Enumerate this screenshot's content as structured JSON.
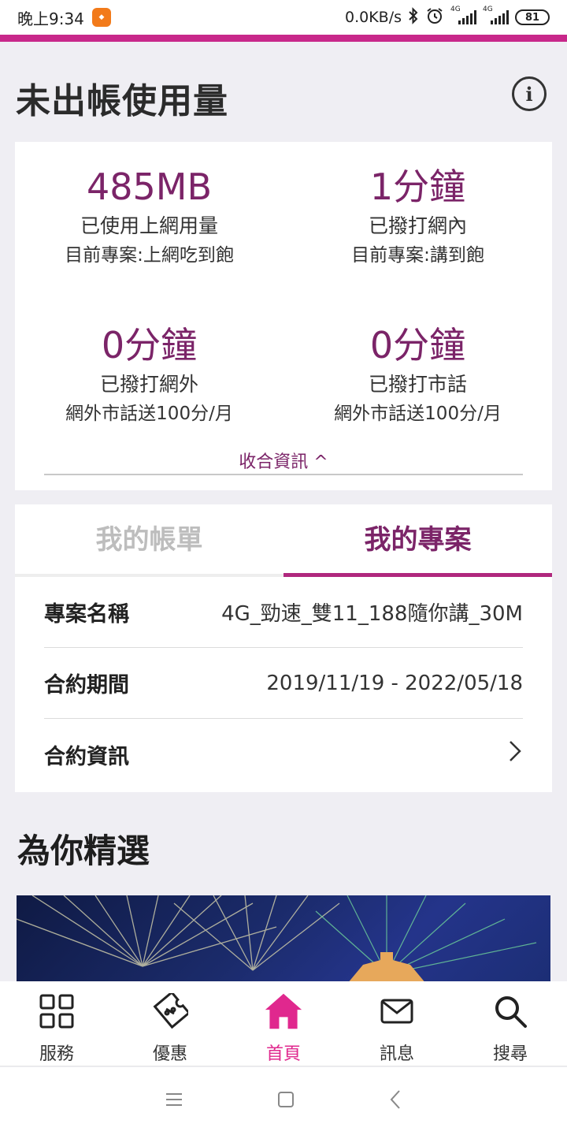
{
  "status_bar": {
    "time": "晚上9:34",
    "network_speed": "0.0KB/s",
    "signal_label_1": "4G",
    "signal_label_2": "4G",
    "battery": "81"
  },
  "header": {
    "title": "未出帳使用量",
    "info_icon": "info-icon"
  },
  "usage": {
    "items": [
      {
        "value": "485MB",
        "label": "已使用上網用量",
        "plan": "目前專案:上網吃到飽"
      },
      {
        "value": "1分鐘",
        "label": "已撥打網內",
        "plan": "目前專案:講到飽"
      },
      {
        "value": "0分鐘",
        "label": "已撥打網外",
        "plan": "網外市話送100分/月"
      },
      {
        "value": "0分鐘",
        "label": "已撥打市話",
        "plan": "網外市話送100分/月"
      }
    ],
    "collapse_label": "收合資訊 ^"
  },
  "tabs": [
    {
      "label": "我的帳單",
      "active": false
    },
    {
      "label": "我的專案",
      "active": true
    }
  ],
  "plan": {
    "name_label": "專案名稱",
    "name_value": "4G_勁速_雙11_188隨你講_30M",
    "period_label": "合約期間",
    "period_value": "2019/11/19 - 2022/05/18",
    "contract_label": "合約資訊"
  },
  "featured": {
    "title": "為你精選"
  },
  "bottom_nav": [
    {
      "label": "服務",
      "icon": "grid-icon"
    },
    {
      "label": "優惠",
      "icon": "coupon-icon"
    },
    {
      "label": "首頁",
      "icon": "home-icon",
      "active": true
    },
    {
      "label": "訊息",
      "icon": "mail-icon"
    },
    {
      "label": "搜尋",
      "icon": "search-icon"
    }
  ],
  "colors": {
    "accent": "#c8288a",
    "value_purple": "#7b2468",
    "nav_active": "#e0288e"
  }
}
